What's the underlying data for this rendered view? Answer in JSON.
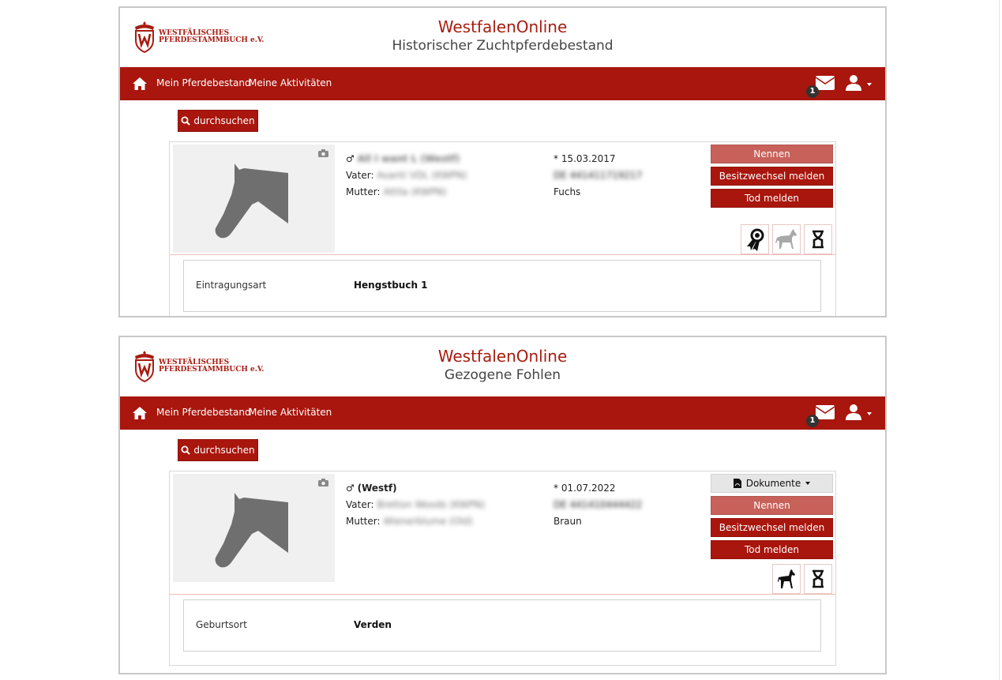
{
  "logo": {
    "line1": "WESTFÄLISCHES",
    "line2": "PFERDESTAMMBUCH e.V."
  },
  "nav": {
    "link1": "Mein Pferdebestand",
    "link2": "Meine Aktivitäten",
    "mail_badge": "1"
  },
  "search": {
    "label": "durchsuchen"
  },
  "colors": {
    "brand": "#a8160d",
    "brand_light": "#c7615a"
  },
  "panels": [
    {
      "title": "WestfalenOnline",
      "subtitle": "Historischer Zuchtpferdebestand",
      "horse": {
        "sex_symbol": "♂",
        "name": "All I want L (Westf)",
        "father_label": "Vater:",
        "father": "Avanti VDL (KWPN)",
        "mother_label": "Mutter:",
        "mother": "Attila (KWPN)",
        "birth": "* 15.03.2017",
        "ueln": "DE 441411719217",
        "color": "Fuchs"
      },
      "buttons": {
        "nennen": "Nennen",
        "besitz": "Besitzwechsel melden",
        "tod": "Tod melden"
      },
      "icons": [
        "award-ribbon-icon",
        "horse-gray-icon",
        "dna-icon"
      ],
      "detail": {
        "label": "Eintragungsart",
        "value": "Hengstbuch 1"
      }
    },
    {
      "title": "WestfalenOnline",
      "subtitle": "Gezogene Fohlen",
      "horse": {
        "sex_symbol": "♂",
        "name": "(Westf)",
        "father_label": "Vater:",
        "father": "Bretton Woods (KWPN)",
        "mother_label": "Mutter:",
        "mother": "Wienerblume (Old)",
        "birth": "* 01.07.2022",
        "ueln": "DE 441410444422",
        "color": "Braun"
      },
      "buttons": {
        "dokumente": "Dokumente",
        "nennen": "Nennen",
        "besitz": "Besitzwechsel melden",
        "tod": "Tod melden"
      },
      "icons": [
        "foal-icon",
        "dna-icon"
      ],
      "detail": {
        "label": "Geburtsort",
        "value": "Verden"
      }
    }
  ]
}
